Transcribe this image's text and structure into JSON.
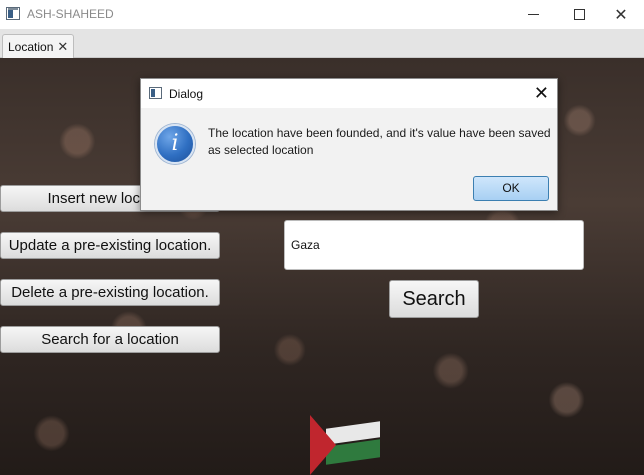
{
  "window": {
    "title": "ASH-SHAHEED",
    "icons": [
      "app-icon",
      "minimize-icon",
      "maximize-icon",
      "close-icon"
    ]
  },
  "tabs": [
    {
      "label": "Location",
      "close": "✕"
    }
  ],
  "sidebar_buttons": {
    "insert": "Insert new location",
    "update": "Update a pre-existing location.",
    "delete": "Delete a pre-existing location.",
    "search": "Search for a location"
  },
  "search": {
    "value": "Gaza",
    "button_label": "Search"
  },
  "dialog": {
    "title": "Dialog",
    "icon": "info-icon",
    "message": "The location have been founded, and it's value have been saved as selected location",
    "ok_label": "OK"
  }
}
